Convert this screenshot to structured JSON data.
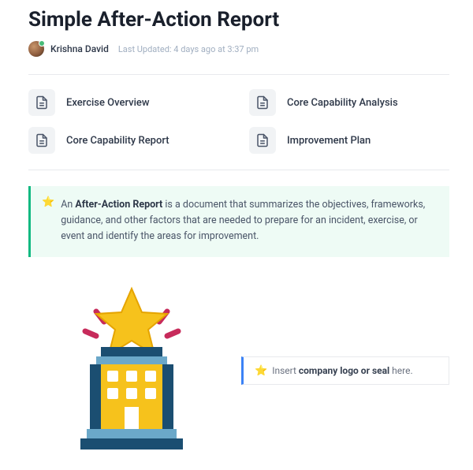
{
  "title": "Simple After-Action Report",
  "author": "Krishna David",
  "updated_label": "Last Updated: 4 days ago at 3:37 pm",
  "toc": [
    {
      "label": "Exercise Overview"
    },
    {
      "label": "Core Capability Analysis"
    },
    {
      "label": "Core Capability Report"
    },
    {
      "label": "Improvement Plan"
    }
  ],
  "definition": {
    "prefix": "An ",
    "term": "After-Action Report",
    "body": " is a document that summarizes the objectives, frameworks, guidance, and other factors that are needed to prepare for an incident, exercise, or event and identify the areas for improvement."
  },
  "logo_prompt": {
    "prefix": "Insert ",
    "bold": "company logo or seal",
    "suffix": " here."
  },
  "icons": {
    "star": "⭐",
    "doc": "document"
  }
}
